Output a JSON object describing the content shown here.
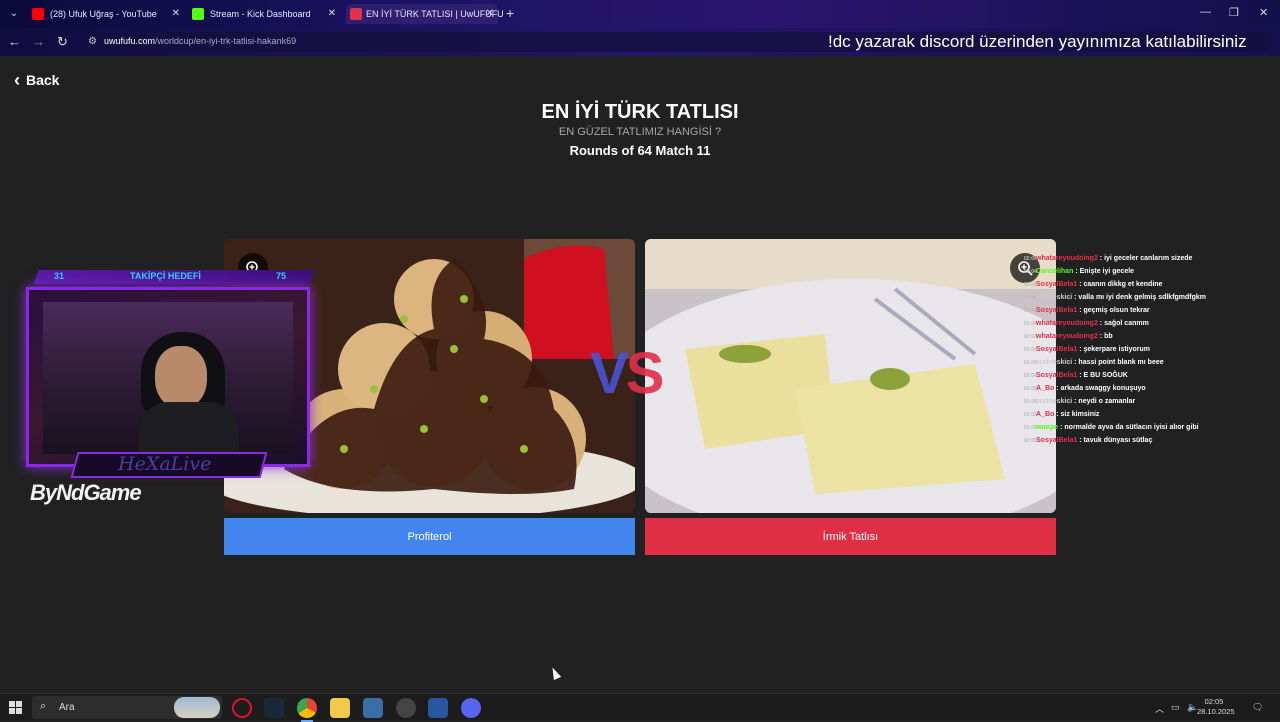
{
  "browser": {
    "tabs": [
      {
        "title": "(28) Ufuk Uğraş - YouTube",
        "favicon_color": "#ff0000"
      },
      {
        "title": "Stream - Kick Dashboard",
        "favicon_color": "#53fc18"
      },
      {
        "title": "EN İYİ TÜRK TATLISI | UwUFUFU",
        "favicon_color": "#e0304a"
      }
    ],
    "new_tab_label": "+",
    "url_domain": "uwufufu.com",
    "url_path": "/worldcup/en-iyi-trk-tatlisi-hakank69"
  },
  "ticker": "!dc yazarak discord üzerinden yayınımıza katılabilirsiniz",
  "page": {
    "back_label": "Back",
    "title": "EN İYİ TÜRK TATLISI",
    "subtitle": "EN GÜZEL TATLIMIZ HANGİSİ ?",
    "round_label": "Rounds of 64 Match 11",
    "vs_left": "V",
    "vs_right": "S",
    "left_choice": "Profiterol",
    "right_choice": "İrmik Tatlısı"
  },
  "overlay": {
    "follow_current": "31",
    "follow_label": "TAKİPÇİ HEDEFİ",
    "follow_goal": "75",
    "streamer_name": "HeXaLive",
    "logo_text": "ByNdGame"
  },
  "chat": [
    {
      "time": "02:04",
      "user": "whatareyoudoing2",
      "color": "#e0304a",
      "text": ": iyi geceler canlarım sizede"
    },
    {
      "time": "02:04",
      "user": "Canselihan",
      "color": "#53fc18",
      "text": ": Enişte iyi gecele"
    },
    {
      "time": "02:04",
      "user": "SosyalBela1",
      "color": "#e0304a",
      "text": ": caanın dikkg et kendine"
    },
    {
      "time": "02:04",
      "user": "ersineskici",
      "color": "#cccccc",
      "text": ": valla mı iyi denk gelmiş sdlkfgmdfgkm"
    },
    {
      "time": "02:04",
      "user": "SosyalBela1",
      "color": "#e0304a",
      "text": ": geçmiş olsun tekrar"
    },
    {
      "time": "02:04",
      "user": "whatareyoudoing2",
      "color": "#e0304a",
      "text": ": sağol canmm"
    },
    {
      "time": "02:04",
      "user": "whatareyoudoing2",
      "color": "#e0304a",
      "text": ": bb"
    },
    {
      "time": "02:04",
      "user": "SosyalBela1",
      "color": "#e0304a",
      "text": ": şekerpare istiyorum"
    },
    {
      "time": "02:04",
      "user": "ersineskici",
      "color": "#cccccc",
      "text": ": hassi point blank mı beee"
    },
    {
      "time": "02:04",
      "user": "SosyalBela1",
      "color": "#e0304a",
      "text": ": E BU SOĞUK"
    },
    {
      "time": "02:05",
      "user": "A_Bo",
      "color": "#e0304a",
      "text": ": arkada swaggy konuşuyo"
    },
    {
      "time": "02:05",
      "user": "ersineskici",
      "color": "#cccccc",
      "text": ": neydi o zamanlar"
    },
    {
      "time": "02:05",
      "user": "A_Bo",
      "color": "#e0304a",
      "text": ": siz kimsiniz"
    },
    {
      "time": "02:05",
      "user": "wuope",
      "color": "#53fc18",
      "text": ": normalde ayva da sütlacın iyisi alıor gibi"
    },
    {
      "time": "02:05",
      "user": "SosyalBela1",
      "color": "#e0304a",
      "text": ": tavuk dünyası sütlaç"
    }
  ],
  "taskbar": {
    "search_label": "Ara",
    "time": "02:05",
    "date": "28.10.2025"
  }
}
